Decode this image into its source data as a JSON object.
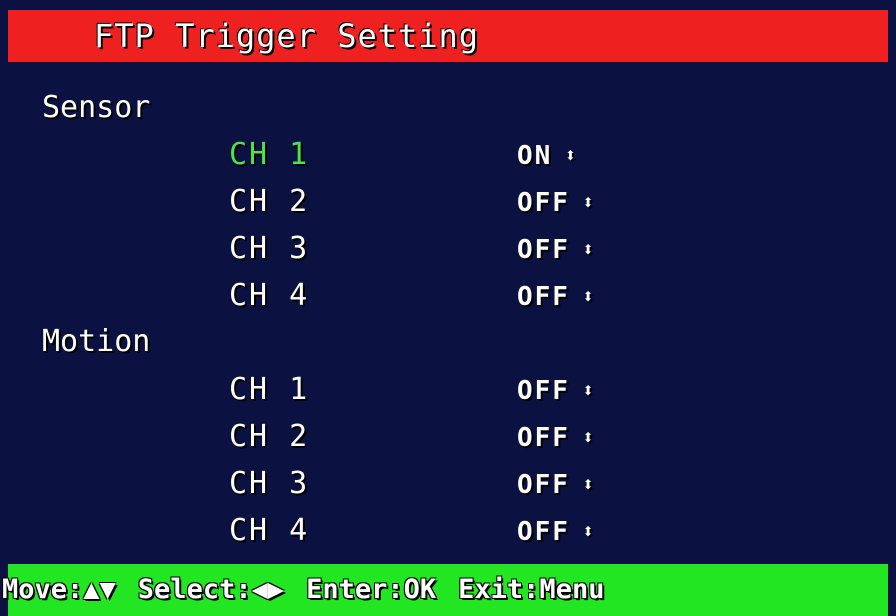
{
  "header": {
    "title": "FTP Trigger Setting"
  },
  "sensor": {
    "label": "Sensor",
    "rows": [
      {
        "channel": "CH 1",
        "value": "ON",
        "arrow": "⬍"
      },
      {
        "channel": "CH 2",
        "value": "OFF",
        "arrow": "⬍"
      },
      {
        "channel": "CH 3",
        "value": "OFF",
        "arrow": "⬍"
      },
      {
        "channel": "CH 4",
        "value": "OFF",
        "arrow": "⬍"
      }
    ]
  },
  "motion": {
    "label": "Motion",
    "rows": [
      {
        "channel": "CH 1",
        "value": "OFF",
        "arrow": "⬍"
      },
      {
        "channel": "CH 2",
        "value": "OFF",
        "arrow": "⬍"
      },
      {
        "channel": "CH 3",
        "value": "OFF",
        "arrow": "⬍"
      },
      {
        "channel": "CH 4",
        "value": "OFF",
        "arrow": "⬍"
      }
    ]
  },
  "footer": {
    "move": "Move:▲▼",
    "select": "Select:◀▶",
    "enter": "Enter:OK",
    "exit": "Exit:Menu"
  },
  "colors": {
    "background": "#0b1140",
    "title_bar": "#ee2020",
    "help_bar": "#22e622",
    "selected_text": "#4be24b"
  }
}
